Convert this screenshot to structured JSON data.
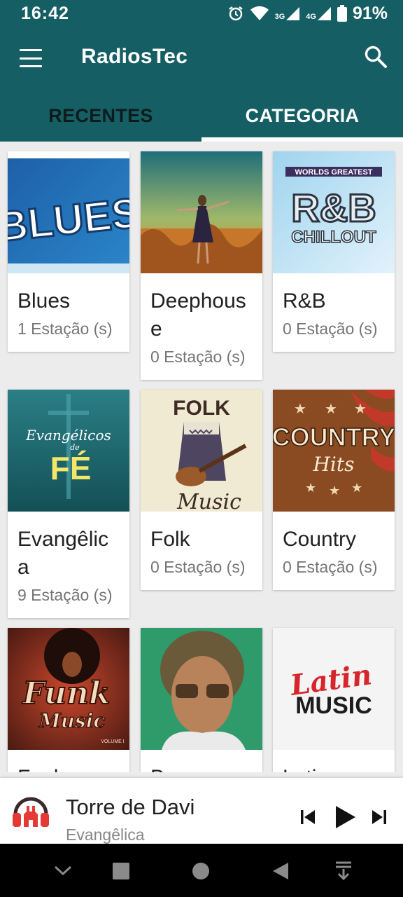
{
  "status_bar": {
    "time": "16:42",
    "network_3g": "3G",
    "network_4g": "4G",
    "battery": "91%",
    "icons": [
      "alarm-icon",
      "wifi-icon",
      "signal-3g-icon",
      "signal-4g-icon",
      "battery-icon"
    ]
  },
  "app_bar": {
    "title": "RadiosTec",
    "tabs": [
      {
        "label": "RECENTES",
        "selected": false
      },
      {
        "label": "CATEGORIA",
        "selected": true
      }
    ]
  },
  "categories": [
    {
      "name": "Blues",
      "count": "1 Estação (s)",
      "art_text": "BLUES"
    },
    {
      "name": "Deephouse",
      "count": "0 Estação (s)"
    },
    {
      "name": "R&B",
      "count": "0 Estação (s)",
      "art_text": [
        "WORLDS GREATEST",
        "R&B",
        "CHILLOUT"
      ]
    },
    {
      "name": "Evangêlica",
      "count": "9 Estação (s)",
      "art_text": [
        "Evangélicos",
        "de",
        "FÉ"
      ]
    },
    {
      "name": "Folk",
      "count": "0 Estação (s)",
      "art_text": [
        "FOLK",
        "Music"
      ]
    },
    {
      "name": "Country",
      "count": "0 Estação (s)",
      "art_text": [
        "COUNTRY",
        "Hits"
      ]
    },
    {
      "name": "Funk",
      "count": "",
      "art_text": [
        "Funk",
        "Music",
        "VOLUME I"
      ]
    },
    {
      "name": "Brega",
      "count": ""
    },
    {
      "name": "Latina",
      "count": "",
      "art_text": [
        "Latin",
        "MUSIC"
      ]
    }
  ],
  "player": {
    "title": "Torre de Davi",
    "subtitle": "Evangêlica"
  },
  "colors": {
    "primary": "#155f64",
    "accent_red": "#e53935",
    "background": "#ececec"
  }
}
